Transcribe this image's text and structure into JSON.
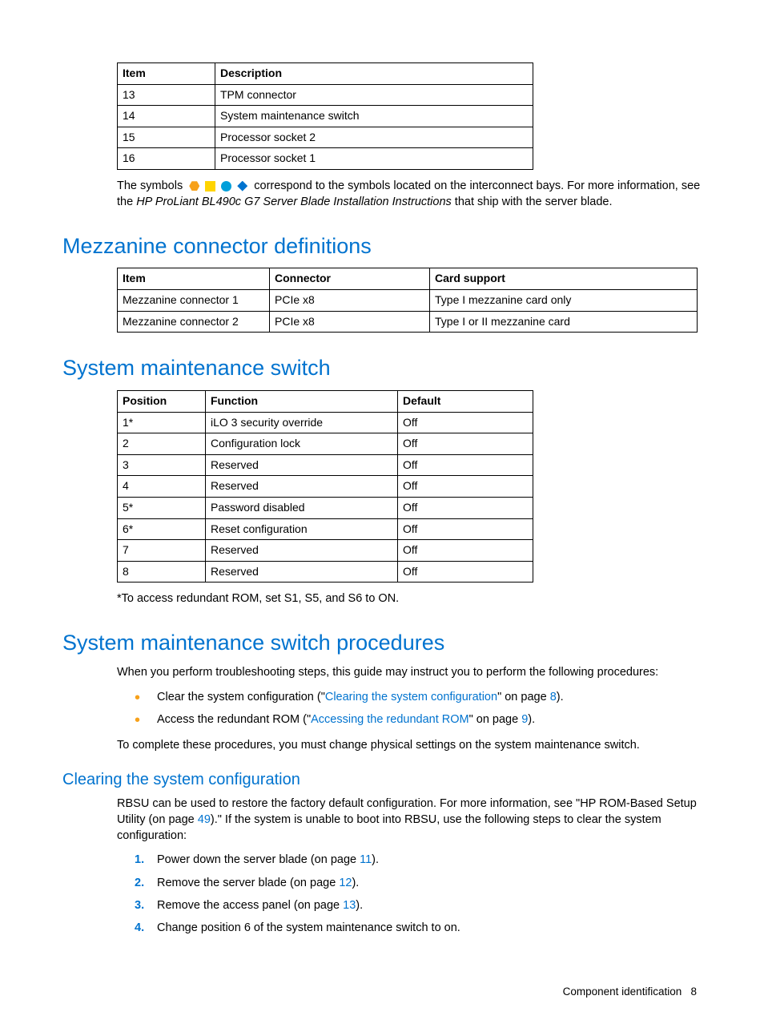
{
  "table1": {
    "headers": [
      "Item",
      "Description"
    ],
    "rows": [
      [
        "13",
        "TPM connector"
      ],
      [
        "14",
        "System maintenance switch"
      ],
      [
        "15",
        "Processor socket 2"
      ],
      [
        "16",
        "Processor socket 1"
      ]
    ]
  },
  "note": {
    "pre": "The symbols",
    "post": "correspond to the symbols located on the interconnect bays. For more information, see the ",
    "italic": "HP ProLiant BL490c G7 Server Blade Installation Instructions",
    "tail": " that ship with the server blade."
  },
  "h1_mezz": "Mezzanine connector definitions",
  "table2": {
    "headers": [
      "Item",
      "Connector",
      "Card support"
    ],
    "rows": [
      [
        "Mezzanine connector 1",
        "PCIe x8",
        "Type I mezzanine card only"
      ],
      [
        "Mezzanine connector 2",
        "PCIe x8",
        "Type I or II mezzanine card"
      ]
    ]
  },
  "h1_sms": "System maintenance switch",
  "table3": {
    "headers": [
      "Position",
      "Function",
      "Default"
    ],
    "rows": [
      [
        "1*",
        "iLO 3 security override",
        "Off"
      ],
      [
        "2",
        "Configuration lock",
        "Off"
      ],
      [
        "3",
        "Reserved",
        "Off"
      ],
      [
        "4",
        "Reserved",
        "Off"
      ],
      [
        "5*",
        "Password disabled",
        "Off"
      ],
      [
        "6*",
        "Reset configuration",
        "Off"
      ],
      [
        "7",
        "Reserved",
        "Off"
      ],
      [
        "8",
        "Reserved",
        "Off"
      ]
    ]
  },
  "sms_footnote": "*To access redundant ROM, set S1, S5, and S6 to ON.",
  "h1_proc": "System maintenance switch procedures",
  "proc_intro": "When you perform troubleshooting steps, this guide may instruct you to perform the following procedures:",
  "bullets": [
    {
      "pre": "Clear the system configuration (\"",
      "link": "Clearing the system configuration",
      "mid": "\" on page ",
      "page": "8",
      "post": ")."
    },
    {
      "pre": "Access the redundant ROM (\"",
      "link": "Accessing the redundant ROM",
      "mid": "\" on page ",
      "page": "9",
      "post": ")."
    }
  ],
  "proc_outro": "To complete these procedures, you must change physical settings on the system maintenance switch.",
  "h2_clear": "Clearing the system configuration",
  "clear_para": {
    "pre": "RBSU can be used to restore the factory default configuration. For more information, see \"HP ROM-Based Setup Utility (on page ",
    "page": "49",
    "post": ").\" If the system is unable to boot into RBSU, use the following steps to clear the system configuration:"
  },
  "steps": [
    {
      "pre": "Power down the server blade (on page ",
      "page": "11",
      "post": ")."
    },
    {
      "pre": "Remove the server blade (on page ",
      "page": "12",
      "post": ")."
    },
    {
      "pre": "Remove the access panel (on page ",
      "page": "13",
      "post": ")."
    },
    {
      "pre": "Change position 6 of the system maintenance switch to on.",
      "page": "",
      "post": ""
    }
  ],
  "footer": {
    "label": "Component identification",
    "page": "8"
  }
}
